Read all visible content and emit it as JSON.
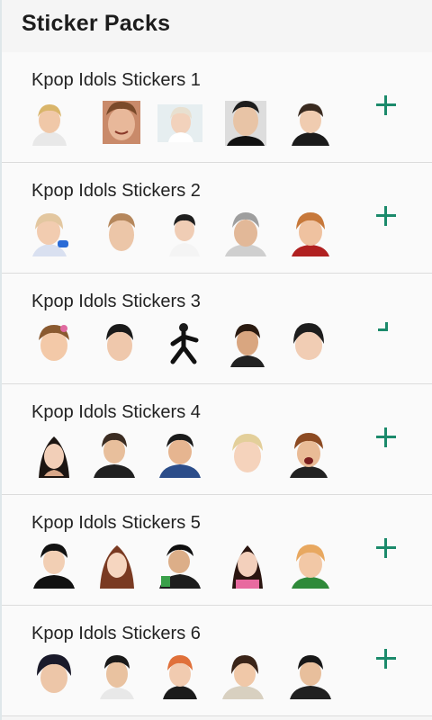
{
  "header": {
    "title": "Sticker Packs"
  },
  "packs": [
    {
      "name": "Kpop Idols Stickers 1",
      "add_state": "full"
    },
    {
      "name": "Kpop Idols Stickers 2",
      "add_state": "full"
    },
    {
      "name": "Kpop Idols Stickers 3",
      "add_state": "partial"
    },
    {
      "name": "Kpop Idols Stickers 4",
      "add_state": "full"
    },
    {
      "name": "Kpop Idols Stickers 5",
      "add_state": "full"
    },
    {
      "name": "Kpop Idols Stickers 6",
      "add_state": "full"
    }
  ],
  "icons": {
    "add": "plus-icon",
    "sticker": "face-sticker-icon"
  },
  "colors": {
    "accent": "#1b8a6b",
    "background": "#f5f5f5",
    "card": "#fafafa"
  }
}
